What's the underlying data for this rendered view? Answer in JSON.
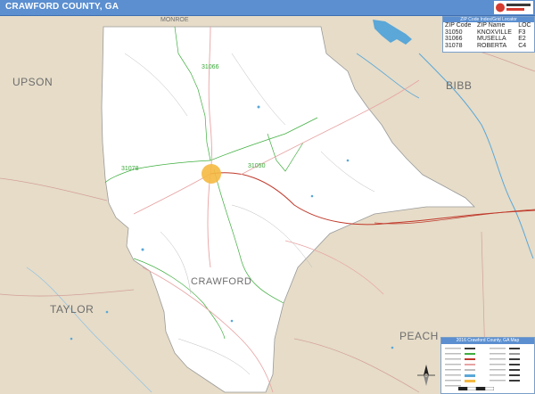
{
  "title": "CRAWFORD COUNTY, GA",
  "counties": {
    "upson": "UPSON",
    "bibb": "BIBB",
    "taylor": "TAYLOR",
    "peach": "PEACH",
    "crawford": "CRAWFORD",
    "monroe": "MONROE"
  },
  "zip_labels": {
    "z31066": "31066",
    "z31078": "31078",
    "z31050": "31050"
  },
  "zip_table": {
    "heading": "ZIP Code Index/Grid Locator",
    "columns": [
      "ZIP Code",
      "ZIP Name",
      "LOC"
    ],
    "rows": [
      [
        "31050",
        "KNOXVILLE",
        "F3"
      ],
      [
        "31066",
        "MUSELLA",
        "E2"
      ],
      [
        "31078",
        "ROBERTA",
        "C4"
      ]
    ]
  },
  "legend": {
    "title": "2016 Crawford County, GA Map"
  },
  "colors": {
    "title_bar": "#5b8fd0",
    "outside_land": "#e6dcc8",
    "county_fill": "#ffffff",
    "zip_boundary": "#3fae3f",
    "major_road": "#c0392b",
    "water": "#5aa7d8",
    "city": "#f5b942"
  }
}
